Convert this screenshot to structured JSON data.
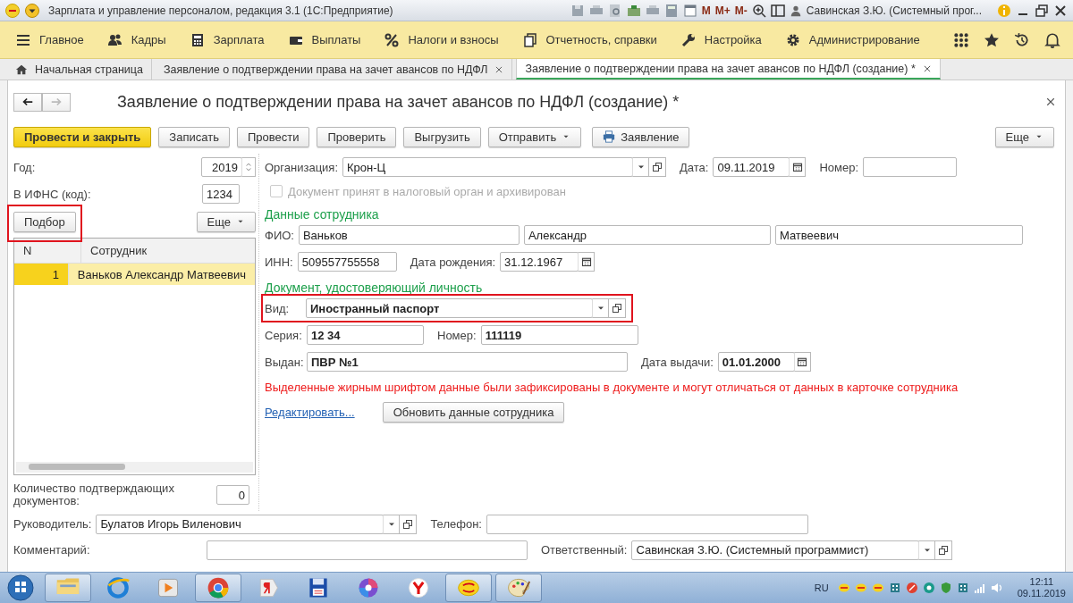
{
  "window": {
    "title": "Зарплата и управление персоналом, редакция 3.1  (1С:Предприятие)",
    "memory_buttons": [
      "M",
      "M+",
      "M-"
    ],
    "user": "Савинская З.Ю. (Системный прог..."
  },
  "menu": [
    {
      "label": "Главное"
    },
    {
      "label": "Кадры"
    },
    {
      "label": "Зарплата"
    },
    {
      "label": "Выплаты"
    },
    {
      "label": "Налоги и взносы"
    },
    {
      "label": "Отчетность, справки"
    },
    {
      "label": "Настройка"
    },
    {
      "label": "Администрирование"
    }
  ],
  "tabs": [
    {
      "label": "Начальная страница",
      "selected": false,
      "kind": "home"
    },
    {
      "label": "Заявление о подтверждении права на зачет авансов по НДФЛ",
      "selected": false,
      "kind": "document"
    },
    {
      "label": "Заявление о подтверждении права на зачет авансов по НДФЛ (создание) *",
      "selected": true,
      "kind": "document"
    }
  ],
  "form": {
    "title": "Заявление о подтверждении права на зачет авансов по НДФЛ (создание) *",
    "toolbar": [
      {
        "label": "Провести и закрыть",
        "kind": "default"
      },
      {
        "label": "Записать",
        "kind": "plain"
      },
      {
        "label": "Провести",
        "kind": "plain"
      },
      {
        "label": "Проверить",
        "kind": "plain"
      },
      {
        "label": "Выгрузить",
        "kind": "plain"
      },
      {
        "label": "Отправить",
        "kind": "dropdown"
      },
      {
        "label": "Заявление",
        "kind": "print"
      }
    ],
    "more": "Еще",
    "year": {
      "label": "Год:",
      "value": "2019"
    },
    "ifns": {
      "label": "В ИФНС (код):",
      "value": "1234"
    },
    "pick_button": {
      "label": "Подбор",
      "highlight": true
    },
    "table_more": "Еще",
    "table": {
      "columns": [
        "N",
        "Сотрудник"
      ],
      "rows": [
        {
          "cells": [
            "1",
            "Ваньков Александр Матвеевич"
          ],
          "selected": true
        }
      ]
    },
    "count": {
      "label": "Количество подтверждающих документов:",
      "value": "0"
    },
    "organization": {
      "label": "Организация:",
      "value": "Крон-Ц"
    },
    "date": {
      "label": "Дата:",
      "value": "09.11.2019"
    },
    "number": {
      "label": "Номер:"
    },
    "archived": {
      "label": "Документ принят в налоговый орган и архивирован",
      "checked": false,
      "disabled": true
    },
    "employee": {
      "heading": "Данные сотрудника",
      "fio_label": "ФИО:",
      "fio": [
        "Ваньков",
        "Александр",
        "Матвеевич"
      ],
      "inn": {
        "label": "ИНН:",
        "value": "509557755558"
      },
      "birth": {
        "label": "Дата рождения:",
        "value": "31.12.1967"
      }
    },
    "document": {
      "heading": "Документ, удостоверяющий личность",
      "kind": {
        "label": "Вид:",
        "value": "Иностранный паспорт",
        "bold": true,
        "highlight": true
      },
      "series": {
        "label": "Серия:",
        "value": "12 34",
        "bold": true
      },
      "number": {
        "label": "Номер:",
        "value": "111119",
        "bold": true
      },
      "issued": {
        "label": "Выдан:",
        "value": "ПВР №1",
        "bold": true
      },
      "issue_date": {
        "label": "Дата выдачи:",
        "value": "01.01.2000",
        "bold": true
      }
    },
    "note": "Выделенные жирным шрифтом данные были зафиксированы в документе и могут отличаться от данных в карточке сотрудника",
    "edit_link": "Редактировать...",
    "refresh_button": "Обновить данные сотрудника",
    "head": {
      "label": "Руководитель:",
      "value": "Булатов Игорь Виленович"
    },
    "phone": {
      "label": "Телефон:"
    },
    "comment": {
      "label": "Комментарий:"
    },
    "responsible": {
      "label": "Ответственный:",
      "value": "Савинская З.Ю. (Системный программист)"
    }
  },
  "taskbar": {
    "apps": [
      {
        "running": true
      },
      {
        "running": false
      },
      {
        "running": false
      },
      {
        "running": true
      },
      {
        "running": false
      },
      {
        "running": false
      },
      {
        "running": false
      },
      {
        "running": false
      },
      {
        "running": true
      },
      {
        "running": true
      }
    ],
    "lang": "RU",
    "time": "12:11",
    "date": "09.11.2019"
  }
}
